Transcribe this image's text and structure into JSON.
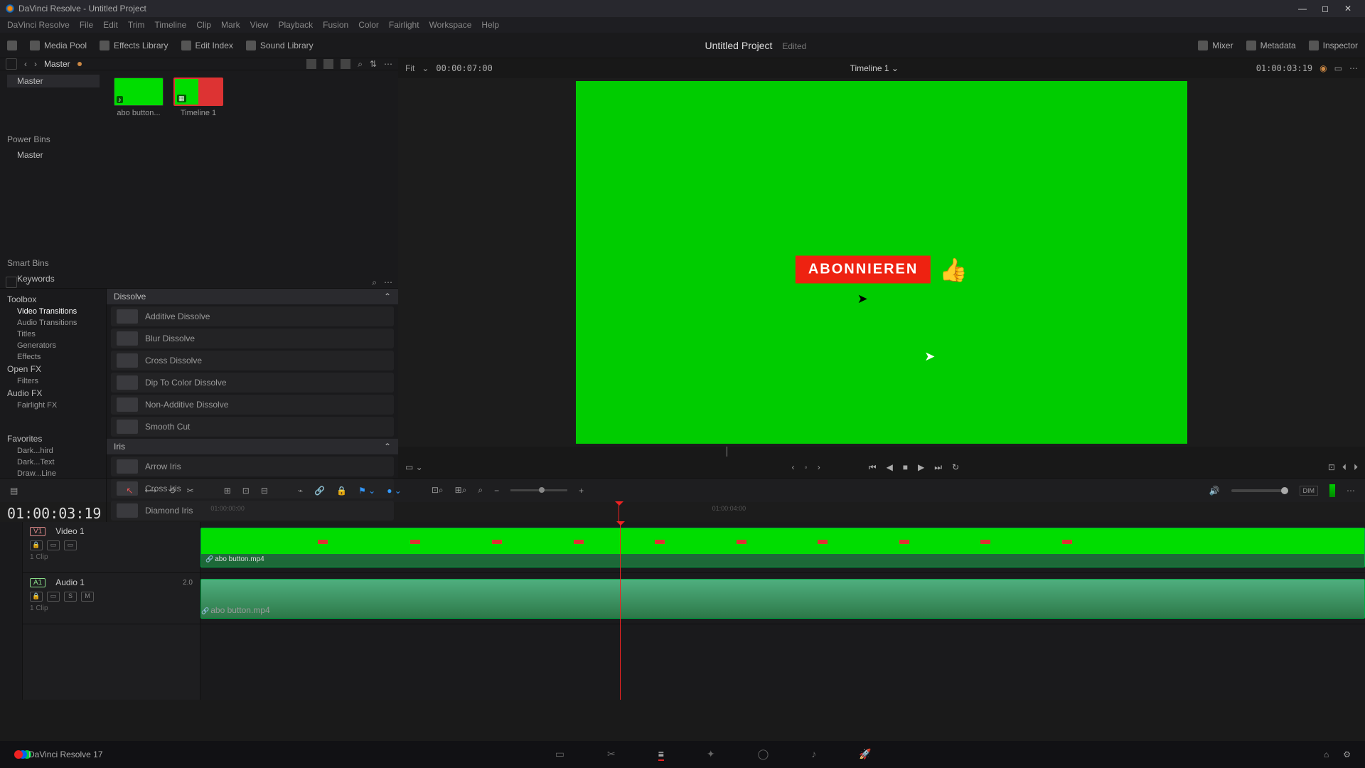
{
  "app": {
    "title": "DaVinci Resolve - Untitled Project",
    "version": "DaVinci Resolve 17"
  },
  "menu": [
    "DaVinci Resolve",
    "File",
    "Edit",
    "Trim",
    "Timeline",
    "Clip",
    "Mark",
    "View",
    "Playback",
    "Fusion",
    "Color",
    "Fairlight",
    "Workspace",
    "Help"
  ],
  "shelf": {
    "left": [
      "Media Pool",
      "Effects Library",
      "Edit Index",
      "Sound Library"
    ],
    "project": "Untitled Project",
    "edited": "Edited",
    "right": [
      "Mixer",
      "Metadata",
      "Inspector"
    ]
  },
  "pool": {
    "title": "Master",
    "bins": {
      "power": "Power Bins",
      "masters": "Master",
      "smart": "Smart Bins",
      "keywords": "Keywords"
    },
    "clips": [
      {
        "name": "abo button...",
        "kind": "clip"
      },
      {
        "name": "Timeline 1",
        "kind": "timeline"
      }
    ]
  },
  "effects": {
    "tree": {
      "toolbox": "Toolbox",
      "video_t": "Video Transitions",
      "audio_t": "Audio Transitions",
      "titles": "Titles",
      "gens": "Generators",
      "fx": "Effects",
      "openfx": "Open FX",
      "filters": "Filters",
      "audiofx": "Audio FX",
      "fairfx": "Fairlight FX",
      "fav": "Favorites",
      "fav_items": [
        "Dark...hird",
        "Dark...Text",
        "Draw...Line"
      ]
    },
    "cats": [
      {
        "name": "Dissolve",
        "items": [
          "Additive Dissolve",
          "Blur Dissolve",
          "Cross Dissolve",
          "Dip To Color Dissolve",
          "Non-Additive Dissolve",
          "Smooth Cut"
        ]
      },
      {
        "name": "Iris",
        "items": [
          "Arrow Iris",
          "Cross Iris",
          "Diamond Iris"
        ]
      }
    ]
  },
  "viewer": {
    "fit": "Fit",
    "source_tc": "00:00:07:00",
    "name": "Timeline 1",
    "record_tc": "01:00:03:19",
    "overlay_button": "ABONNIEREN"
  },
  "timeline": {
    "bigtc": "01:00:03:19",
    "ticks": [
      "01:00:00:00",
      "01:00:04:00"
    ],
    "tracks": {
      "v1": {
        "tag": "V1",
        "name": "Video 1",
        "meta": "1 Clip",
        "clip": "abo button.mp4"
      },
      "a1": {
        "tag": "A1",
        "name": "Audio 1",
        "gain": "2.0",
        "meta": "1 Clip",
        "clip": "abo button.mp4",
        "m": "M",
        "s": "S"
      }
    }
  },
  "pages": [
    "⌂",
    "✂",
    "≡",
    "✎",
    "◯",
    "♪",
    "✈"
  ]
}
